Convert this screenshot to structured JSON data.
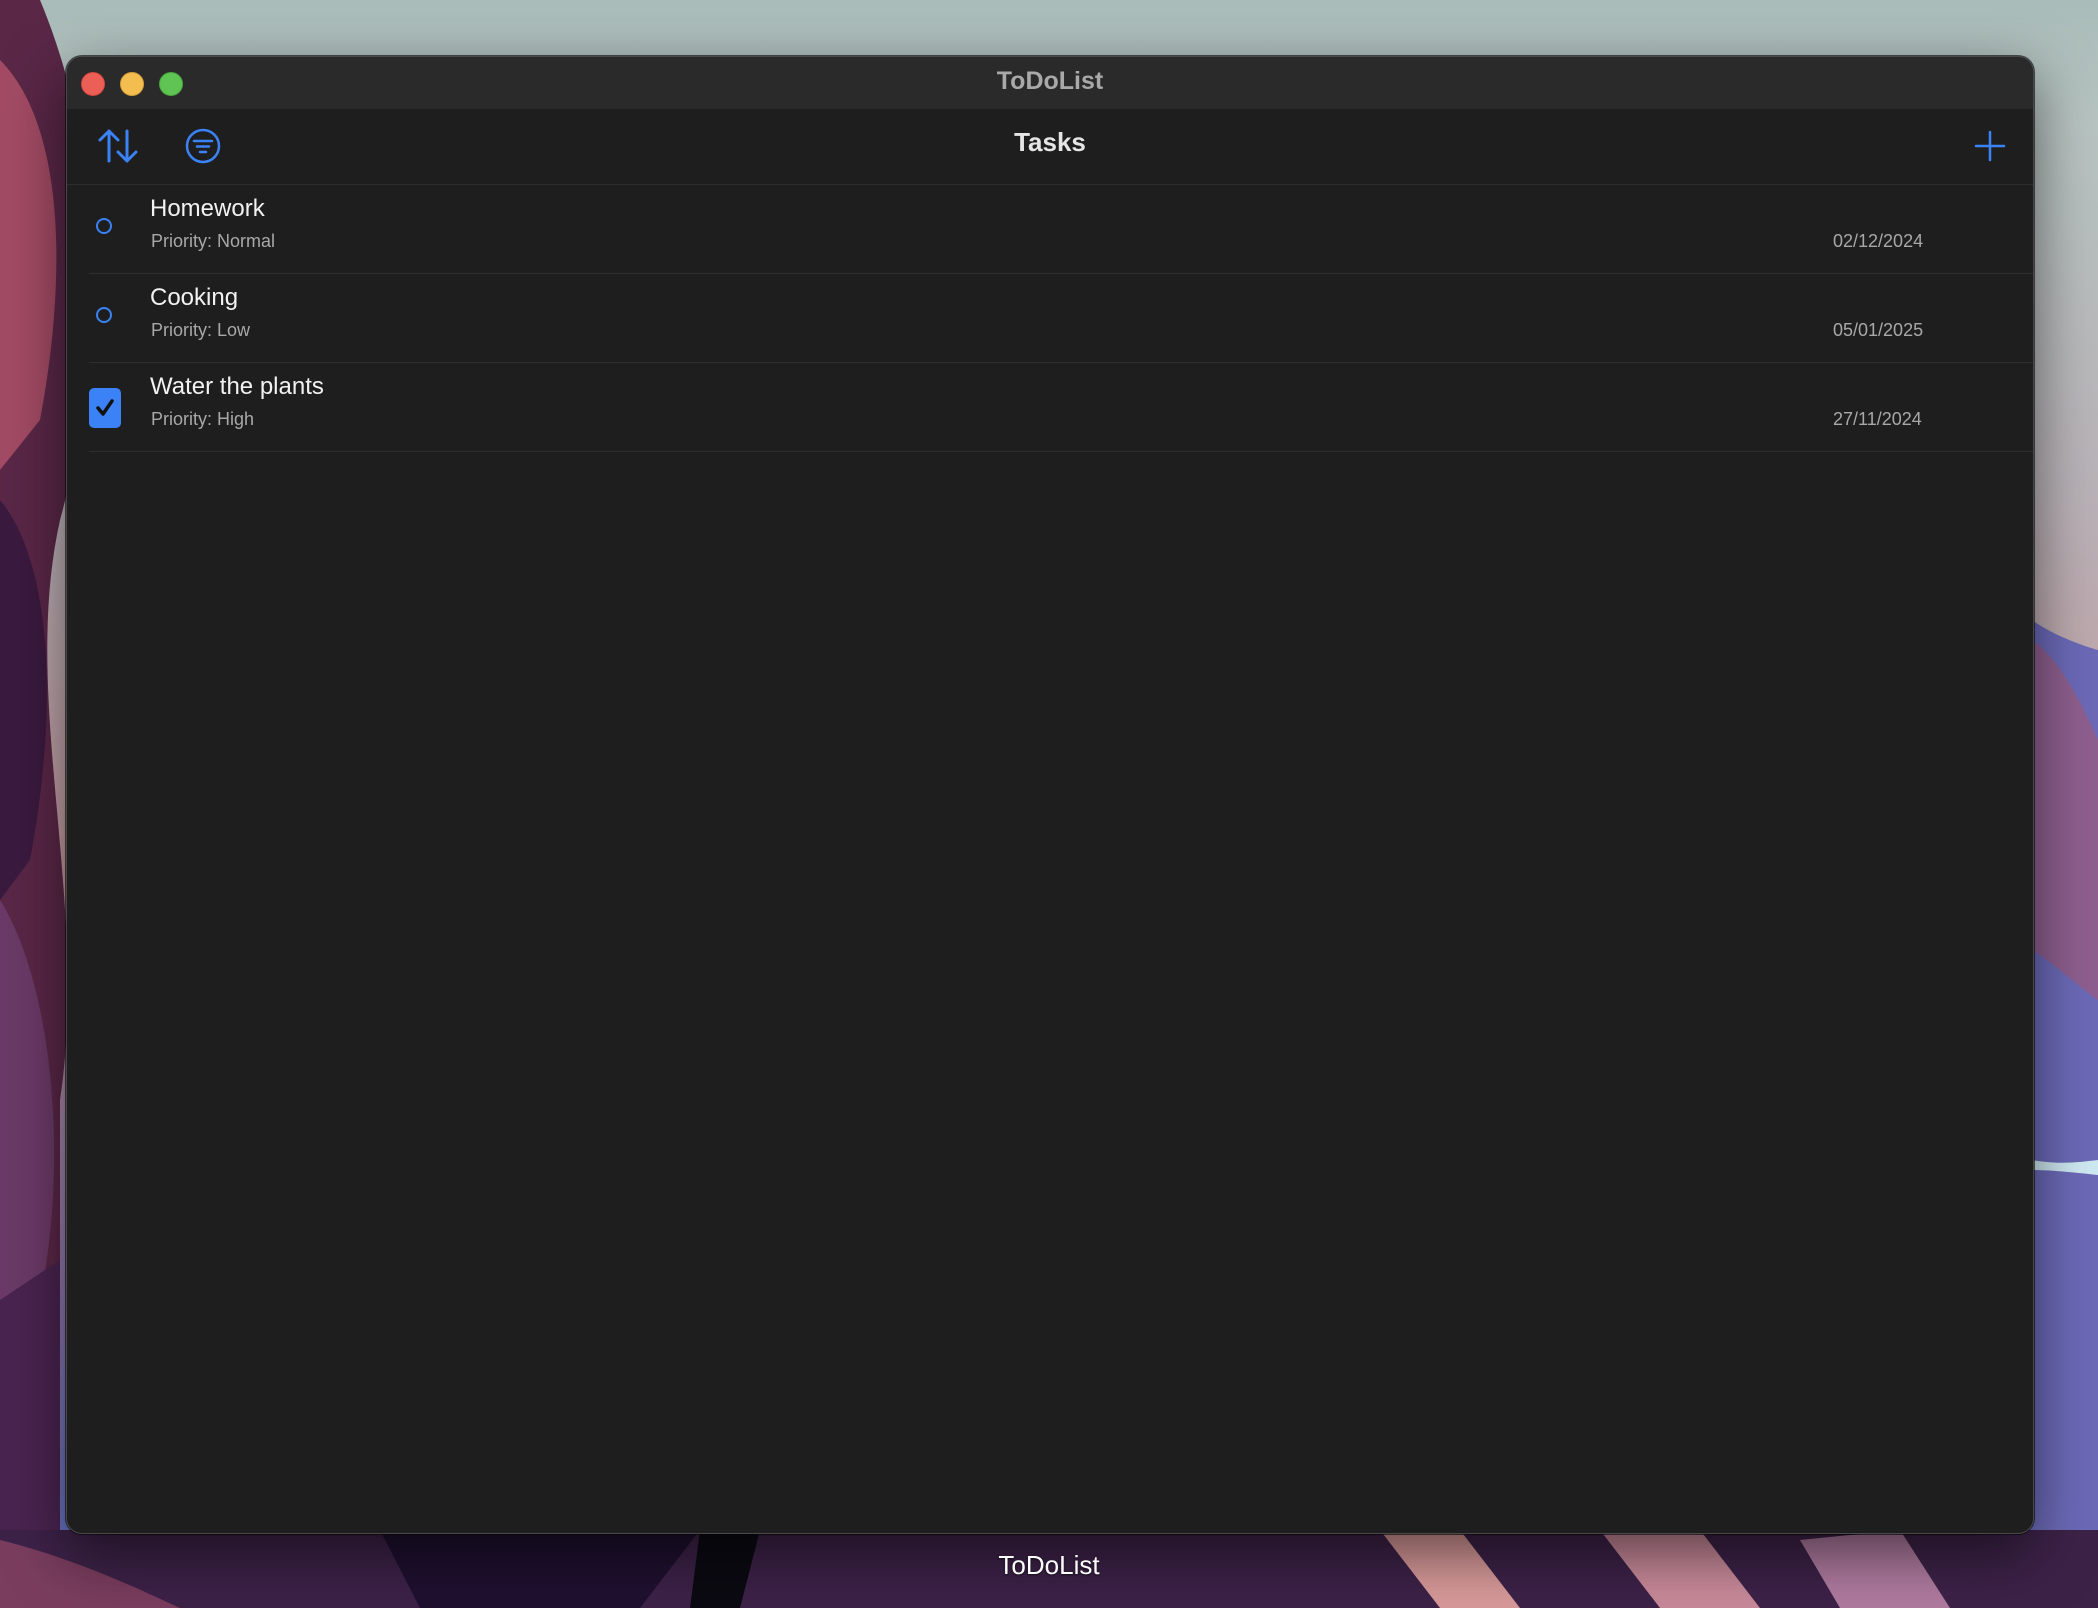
{
  "window": {
    "title": "ToDoList"
  },
  "toolbar": {
    "title": "Tasks",
    "sort_icon": "sort-arrows-icon",
    "filter_icon": "filter-circle-icon",
    "add_icon": "plus-icon"
  },
  "tasks": [
    {
      "name": "Homework",
      "priority": "Priority: Normal",
      "date": "02/12/2024",
      "completed": false
    },
    {
      "name": "Cooking",
      "priority": "Priority: Low",
      "date": "05/01/2025",
      "completed": false
    },
    {
      "name": "Water the plants",
      "priority": "Priority: High",
      "date": "27/11/2024",
      "completed": true
    }
  ],
  "dock": {
    "app_label": "ToDoList"
  },
  "colors": {
    "accent": "#3b82f6",
    "window_bg": "#1e1e1e",
    "titlebar_bg": "#2a2a2a"
  }
}
